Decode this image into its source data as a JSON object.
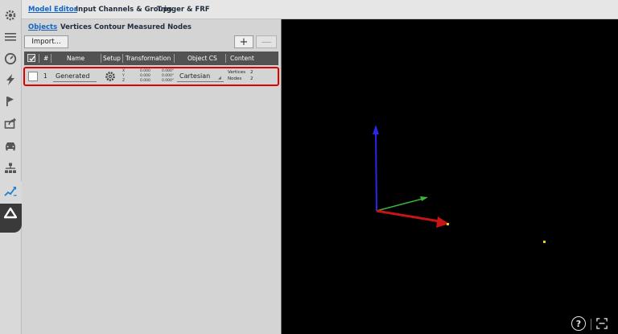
{
  "top_tabs": [
    {
      "label": "Model Editor",
      "active": true
    },
    {
      "label": "Input Channels & Groups",
      "active": false
    },
    {
      "label": "Trigger & FRF",
      "active": false
    }
  ],
  "sub_tabs": [
    {
      "label": "Objects",
      "active": true
    },
    {
      "label": "Vertices",
      "active": false
    },
    {
      "label": "Contour",
      "active": false
    },
    {
      "label": "Measured Nodes",
      "active": false
    }
  ],
  "toolbar": {
    "import_label": "Import...",
    "add_label": "+",
    "remove_label": "—"
  },
  "table": {
    "headers": {
      "num": "#",
      "name": "Name",
      "setup": "Setup",
      "transformation": "Transformation",
      "object_cs": "Object CS",
      "content": "Content"
    },
    "rows": [
      {
        "num": "1",
        "name": "Generated",
        "transform": {
          "axes": [
            "X",
            "Y",
            "Z"
          ],
          "translation": [
            "0.000",
            "0.000",
            "0.000"
          ],
          "rotation": [
            "0.000°",
            "0.000°",
            "0.000°"
          ]
        },
        "object_cs": "Cartesian",
        "content": {
          "vertices_label": "Vertices",
          "vertices_count": "2",
          "nodes_label": "Nodes",
          "nodes_count": "2"
        }
      }
    ]
  },
  "viewport": {
    "help_label": "?",
    "axis_colors": {
      "x": "#c81414",
      "y": "#3cb43c",
      "z": "#2828e6"
    },
    "node_color": "#e6d21e"
  },
  "sidebar_icons": [
    "settings-gear-icon",
    "list-icon",
    "gauge-icon",
    "lightning-icon",
    "flag-icon",
    "export-icon",
    "car-icon",
    "hierarchy-icon",
    "modal-analysis-icon",
    "triangle-icon"
  ]
}
